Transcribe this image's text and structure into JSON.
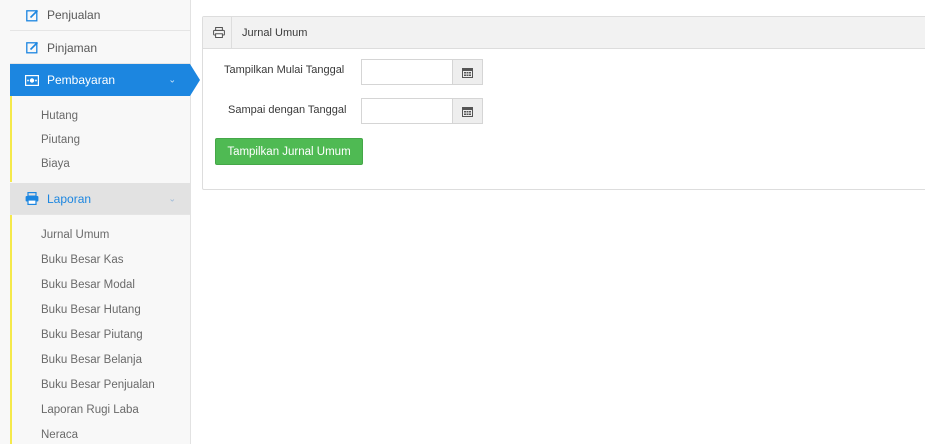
{
  "sidebar": {
    "items": [
      {
        "label": "Penjualan",
        "icon": "edit-icon"
      },
      {
        "label": "Pinjaman",
        "icon": "edit-icon"
      },
      {
        "label": "Pembayaran",
        "icon": "money-icon",
        "active": true
      },
      {
        "label": "Laporan",
        "icon": "print-icon",
        "open": true
      }
    ],
    "pembayaran_sub": [
      "Hutang",
      "Piutang",
      "Biaya"
    ],
    "laporan_sub": [
      "Jurnal Umum",
      "Buku Besar Kas",
      "Buku Besar Modal",
      "Buku Besar Hutang",
      "Buku Besar Piutang",
      "Buku Besar Belanja",
      "Buku Besar Penjualan",
      "Laporan Rugi Laba",
      "Neraca"
    ]
  },
  "panel": {
    "title": "Jurnal Umum",
    "title_icon": "print-icon",
    "start_label": "Tampilkan Mulai Tanggal",
    "start_value": "",
    "end_label": "Sampai dengan Tanggal",
    "end_value": "",
    "submit_label": "Tampilkan Jurnal Umum"
  },
  "colors": {
    "accent": "#1c86e0",
    "success": "#4fba53",
    "sidebar_bg": "#f8f8f8",
    "highlight_bar": "#f5e94b"
  }
}
